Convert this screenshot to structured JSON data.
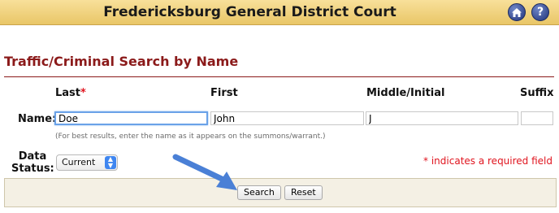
{
  "header": {
    "title": "Fredericksburg General District Court",
    "home_icon": "home-icon",
    "help_icon": "help-icon",
    "help_glyph": "?"
  },
  "page": {
    "title": "Traffic/Criminal Search by Name"
  },
  "form": {
    "columns": {
      "last": "Last",
      "required_marker": "*",
      "first": "First",
      "middle": "Middle/Initial",
      "suffix": "Suffix"
    },
    "name_label": "Name:",
    "fields": {
      "last": "Doe",
      "first": "John",
      "middle": "J",
      "suffix": ""
    },
    "hint": "(For best results, enter the name as it appears on the summons/warrant.)",
    "data_status_label_line1": "Data",
    "data_status_label_line2": "Status:",
    "data_status_selected": "Current",
    "required_note": "* indicates a required field"
  },
  "buttons": {
    "search": "Search",
    "reset": "Reset"
  },
  "colors": {
    "header_bg": "#f0d27a",
    "title_red": "#8b1a1a",
    "required_red": "#e0141e",
    "icon_blue": "#22347a",
    "annotation_arrow": "#4a80d6"
  }
}
